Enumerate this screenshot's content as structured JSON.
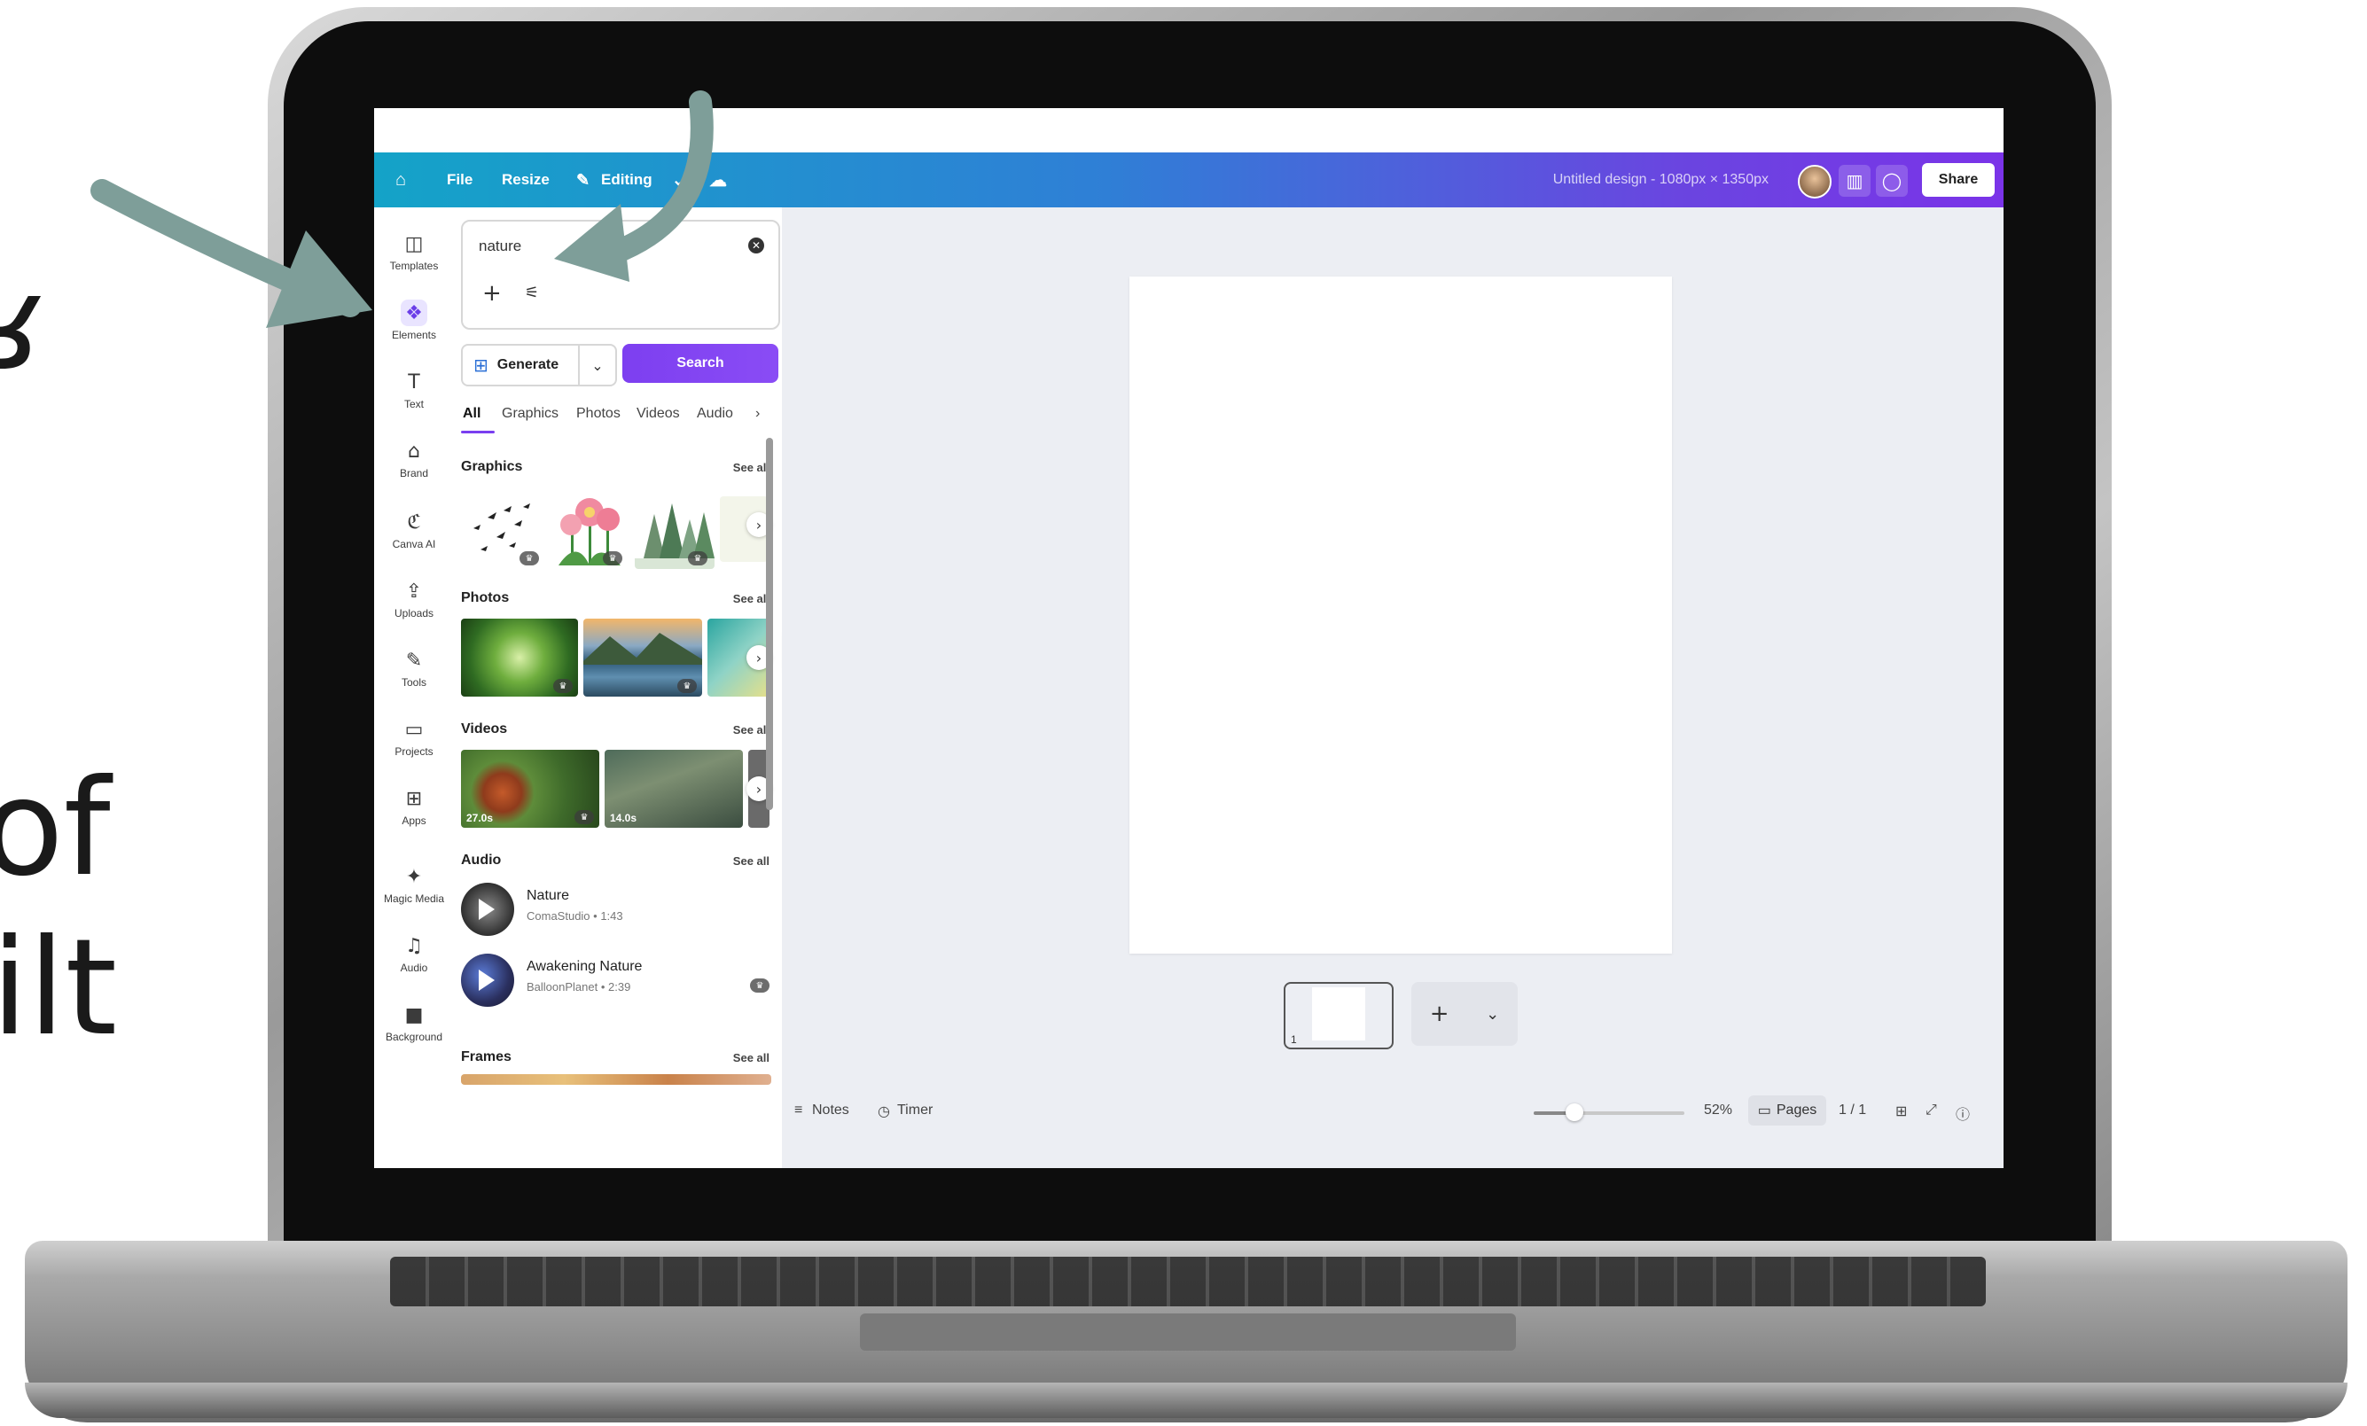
{
  "side_text": {
    "line1": "ʁ",
    "line2": ")",
    "line3": "of",
    "line4": "ilt"
  },
  "app": {
    "brand_color": "#7d3ff0",
    "topbar": {
      "home_icon": "home-icon",
      "file_label": "File",
      "resize_label": "Resize",
      "editing_label": "Editing",
      "cloud_icon": "cloud-sync-icon",
      "title": "Untitled design - 1080px × 1350px",
      "insights_icon": "bar-chart-icon",
      "comment_icon": "comment-icon",
      "share_label": "Share"
    },
    "rail": [
      {
        "label": "Templates",
        "icon": "templates-icon",
        "glyph": "◫",
        "active": false
      },
      {
        "label": "Elements",
        "icon": "elements-icon",
        "glyph": "❖",
        "active": true
      },
      {
        "label": "Text",
        "icon": "text-icon",
        "glyph": "T",
        "active": false
      },
      {
        "label": "Brand",
        "icon": "brand-icon",
        "glyph": "⌂",
        "active": false
      },
      {
        "label": "Canva AI",
        "icon": "canva-ai-icon",
        "glyph": "ℭ",
        "active": false
      },
      {
        "label": "Uploads",
        "icon": "uploads-icon",
        "glyph": "⇪",
        "active": false
      },
      {
        "label": "Tools",
        "icon": "tools-icon",
        "glyph": "✎",
        "active": false
      },
      {
        "label": "Projects",
        "icon": "projects-icon",
        "glyph": "▭",
        "active": false
      },
      {
        "label": "Apps",
        "icon": "apps-icon",
        "glyph": "⊞",
        "active": false
      },
      {
        "label": "Magic Media",
        "icon": "magic-media-icon",
        "glyph": "✦",
        "active": false
      },
      {
        "label": "Audio",
        "icon": "audio-icon",
        "glyph": "♫",
        "active": false
      },
      {
        "label": "Background",
        "icon": "background-icon",
        "glyph": "■",
        "active": false
      }
    ],
    "panel": {
      "search_value": "nature",
      "generate_label": "Generate",
      "search_label": "Search",
      "tabs": [
        "All",
        "Graphics",
        "Photos",
        "Videos",
        "Audio"
      ],
      "active_tab": "All",
      "sections": {
        "graphics": "Graphics",
        "photos": "Photos",
        "videos": "Videos",
        "audio": "Audio",
        "frames": "Frames"
      },
      "see_all": "See all",
      "video_durations": [
        "27.0s",
        "14.0s"
      ],
      "audio_tracks": [
        {
          "title": "Nature",
          "sub": "ComaStudio • 1:43"
        },
        {
          "title": "Awakening Nature",
          "sub": "BalloonPlanet • 2:39"
        }
      ]
    },
    "canvas": {
      "page_number": "1",
      "notes_label": "Notes",
      "timer_label": "Timer",
      "zoom": "52%",
      "zoom_level": 0.27,
      "pages_label": "Pages",
      "page_count": "1 / 1"
    }
  }
}
